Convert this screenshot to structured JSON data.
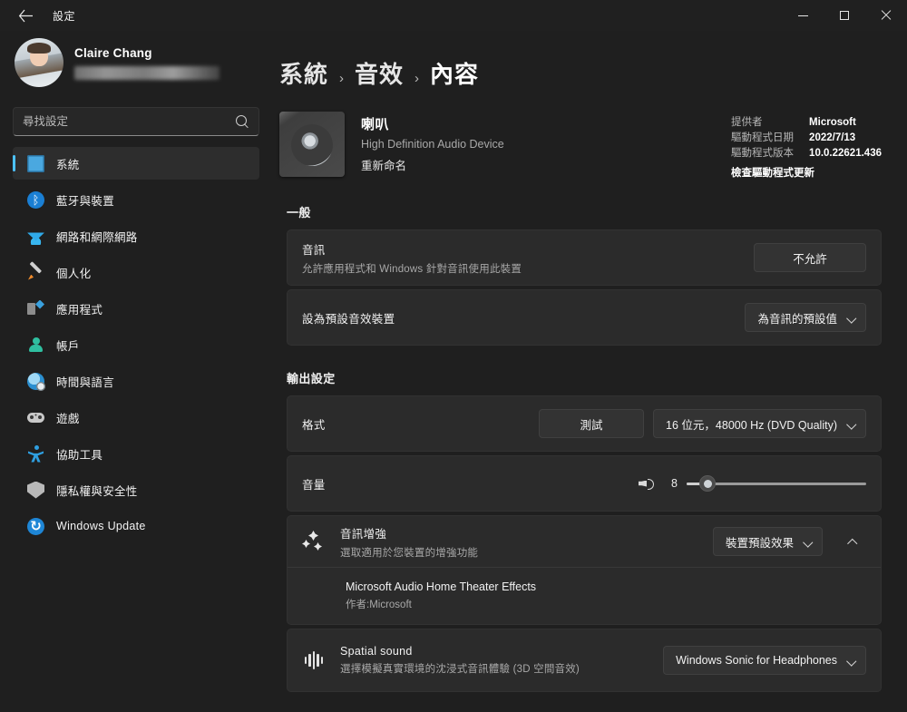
{
  "window": {
    "title": "設定",
    "back_icon": "back-arrow-icon",
    "controls": {
      "minimize": "minimize-icon",
      "maximize": "maximize-icon",
      "close": "close-icon"
    }
  },
  "sidebar": {
    "profile": {
      "name": "Claire Chang",
      "email_redacted": ""
    },
    "search": {
      "placeholder": "尋找設定",
      "value": "",
      "icon": "search-icon"
    },
    "items": [
      {
        "label": "系統",
        "icon": "monitor-icon",
        "active": true
      },
      {
        "label": "藍牙與裝置",
        "icon": "bluetooth-icon",
        "active": false
      },
      {
        "label": "網路和網際網路",
        "icon": "wifi-icon",
        "active": false
      },
      {
        "label": "個人化",
        "icon": "paintbrush-icon",
        "active": false
      },
      {
        "label": "應用程式",
        "icon": "apps-icon",
        "active": false
      },
      {
        "label": "帳戶",
        "icon": "account-icon",
        "active": false
      },
      {
        "label": "時間與語言",
        "icon": "clock-icon",
        "active": false
      },
      {
        "label": "遊戲",
        "icon": "gamepad-icon",
        "active": false
      },
      {
        "label": "協助工具",
        "icon": "accessibility-icon",
        "active": false
      },
      {
        "label": "隱私權與安全性",
        "icon": "shield-icon",
        "active": false
      },
      {
        "label": "Windows Update",
        "icon": "update-icon",
        "active": false
      }
    ]
  },
  "breadcrumb": {
    "root": "系統",
    "mid": "音效",
    "current": "內容",
    "separator": "›"
  },
  "device": {
    "icon": "speaker-icon",
    "name": "喇叭",
    "subtitle": "High Definition Audio Device",
    "rename_link": "重新命名",
    "driver": {
      "provider_key": "提供者",
      "provider_val": "Microsoft",
      "date_key": "驅動程式日期",
      "date_val": "2022/7/13",
      "version_key": "驅動程式版本",
      "version_val": "10.0.22621.436",
      "check_update_link": "檢查驅動程式更新"
    }
  },
  "general": {
    "title": "一般",
    "audio": {
      "label": "音訊",
      "desc": "允許應用程式和 Windows 針對音訊使用此裝置",
      "button": "不允許"
    },
    "default_device": {
      "label": "設為預設音效裝置",
      "dropdown_value": "為音訊的預設值",
      "chevron": "chevron-down-icon"
    }
  },
  "output": {
    "title": "輸出設定",
    "format": {
      "label": "格式",
      "test_button": "測試",
      "dropdown_value": "16 位元，48000 Hz (DVD Quality)",
      "chevron": "chevron-down-icon"
    },
    "volume": {
      "label": "音量",
      "icon": "volume-icon",
      "value": "8",
      "percent": 8,
      "min": 0,
      "max": 100
    }
  },
  "enhance": {
    "icon": "sparkle-icon",
    "label": "音訊增強",
    "desc": "選取適用於您裝置的增強功能",
    "dropdown_value": "裝置預設效果",
    "chevron": "chevron-down-icon",
    "expand_chevron": "chevron-up-icon",
    "effect": {
      "title": "Microsoft Audio Home Theater Effects",
      "author": "作者:Microsoft"
    }
  },
  "spatial": {
    "icon": "waveform-icon",
    "label": "Spatial sound",
    "desc": "選擇模擬真實環境的沈浸式音訊體驗 (3D 空間音效)",
    "dropdown_value": "Windows Sonic for Headphones",
    "chevron": "chevron-down-icon"
  },
  "colors": {
    "accent": "#4cc2ff",
    "card_bg": "#2b2b2b",
    "page_bg": "#1f1f1f"
  }
}
